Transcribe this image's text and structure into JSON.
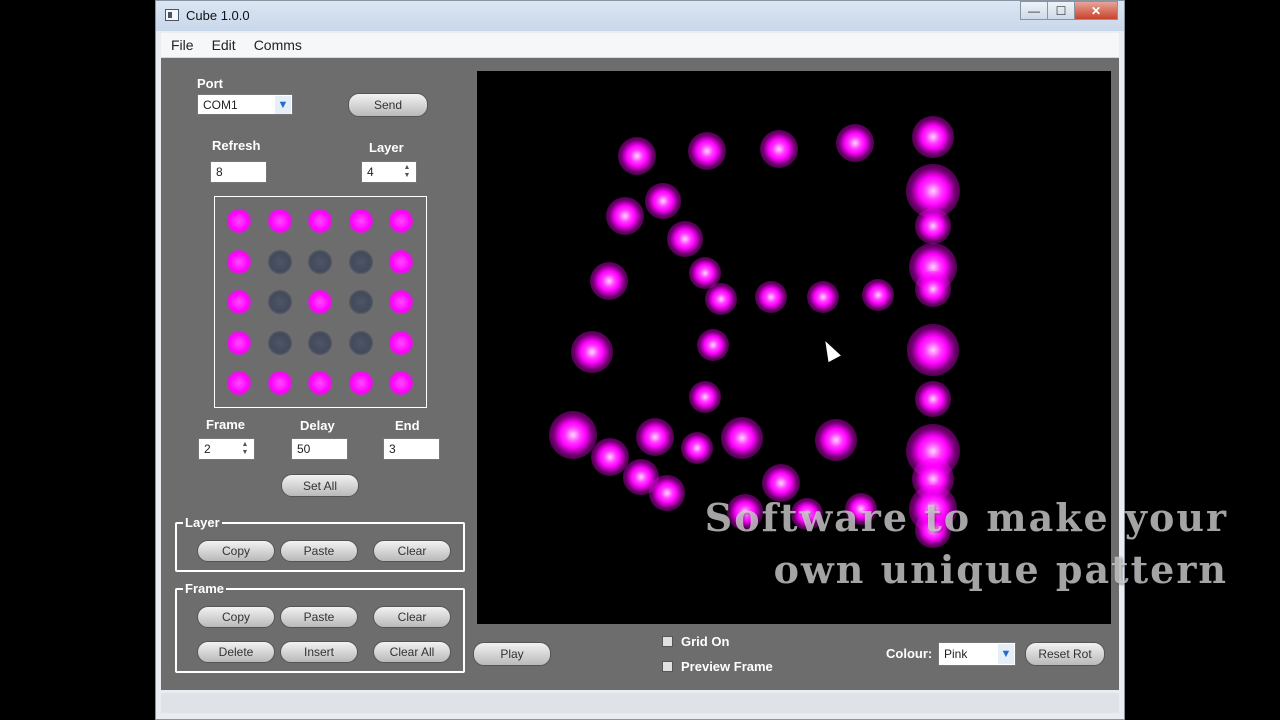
{
  "window": {
    "title": "Cube 1.0.0",
    "controls": {
      "minimize": "—",
      "maximize": "☐",
      "close": "✕"
    }
  },
  "menu": [
    "File",
    "Edit",
    "Comms"
  ],
  "port": {
    "label": "Port",
    "value": "COM1"
  },
  "send_button": "Send",
  "refresh": {
    "label": "Refresh",
    "value": "8"
  },
  "layer": {
    "label": "Layer",
    "value": "4"
  },
  "grid": [
    [
      1,
      1,
      1,
      1,
      1
    ],
    [
      1,
      0,
      0,
      0,
      1
    ],
    [
      1,
      0,
      1,
      0,
      1
    ],
    [
      1,
      0,
      0,
      0,
      1
    ],
    [
      1,
      1,
      1,
      1,
      1
    ]
  ],
  "frame": {
    "label": "Frame",
    "value": "2"
  },
  "delay": {
    "label": "Delay",
    "value": "50"
  },
  "end": {
    "label": "End",
    "value": "3"
  },
  "set_all_button": "Set All",
  "layer_group": {
    "title": "Layer",
    "copy": "Copy",
    "paste": "Paste",
    "clear": "Clear"
  },
  "frame_group": {
    "title": "Frame",
    "copy": "Copy",
    "paste": "Paste",
    "clear": "Clear",
    "delete": "Delete",
    "insert": "Insert",
    "clear_all": "Clear All"
  },
  "play_button": "Play",
  "grid_on": {
    "label": "Grid On",
    "checked": false
  },
  "preview_frame": {
    "label": "Preview Frame",
    "checked": false
  },
  "colour": {
    "label": "Colour:",
    "value": "Pink"
  },
  "reset_rot_button": "Reset Rot",
  "overlay": {
    "line1": "Software to make your",
    "line2": "own unique pattern"
  },
  "colors": {
    "led_on": "#ff00ff",
    "led_off": "#424a5b",
    "panel_bg": "#6d6d6d",
    "canvas_bg": "#000000"
  }
}
